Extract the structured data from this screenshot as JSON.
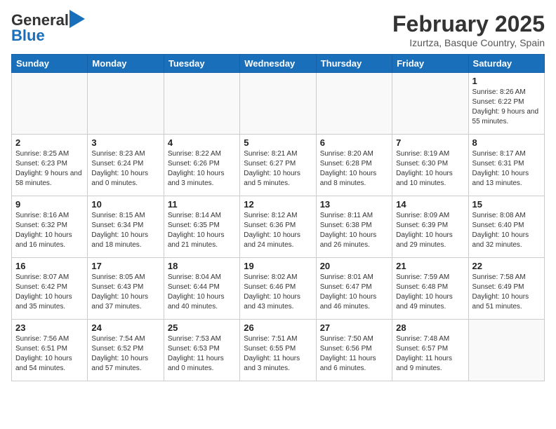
{
  "header": {
    "logo_general": "General",
    "logo_blue": "Blue",
    "title": "February 2025",
    "location": "Izurtza, Basque Country, Spain"
  },
  "days_of_week": [
    "Sunday",
    "Monday",
    "Tuesday",
    "Wednesday",
    "Thursday",
    "Friday",
    "Saturday"
  ],
  "weeks": [
    [
      {
        "day": "",
        "info": ""
      },
      {
        "day": "",
        "info": ""
      },
      {
        "day": "",
        "info": ""
      },
      {
        "day": "",
        "info": ""
      },
      {
        "day": "",
        "info": ""
      },
      {
        "day": "",
        "info": ""
      },
      {
        "day": "1",
        "info": "Sunrise: 8:26 AM\nSunset: 6:22 PM\nDaylight: 9 hours and 55 minutes."
      }
    ],
    [
      {
        "day": "2",
        "info": "Sunrise: 8:25 AM\nSunset: 6:23 PM\nDaylight: 9 hours and 58 minutes."
      },
      {
        "day": "3",
        "info": "Sunrise: 8:23 AM\nSunset: 6:24 PM\nDaylight: 10 hours and 0 minutes."
      },
      {
        "day": "4",
        "info": "Sunrise: 8:22 AM\nSunset: 6:26 PM\nDaylight: 10 hours and 3 minutes."
      },
      {
        "day": "5",
        "info": "Sunrise: 8:21 AM\nSunset: 6:27 PM\nDaylight: 10 hours and 5 minutes."
      },
      {
        "day": "6",
        "info": "Sunrise: 8:20 AM\nSunset: 6:28 PM\nDaylight: 10 hours and 8 minutes."
      },
      {
        "day": "7",
        "info": "Sunrise: 8:19 AM\nSunset: 6:30 PM\nDaylight: 10 hours and 10 minutes."
      },
      {
        "day": "8",
        "info": "Sunrise: 8:17 AM\nSunset: 6:31 PM\nDaylight: 10 hours and 13 minutes."
      }
    ],
    [
      {
        "day": "9",
        "info": "Sunrise: 8:16 AM\nSunset: 6:32 PM\nDaylight: 10 hours and 16 minutes."
      },
      {
        "day": "10",
        "info": "Sunrise: 8:15 AM\nSunset: 6:34 PM\nDaylight: 10 hours and 18 minutes."
      },
      {
        "day": "11",
        "info": "Sunrise: 8:14 AM\nSunset: 6:35 PM\nDaylight: 10 hours and 21 minutes."
      },
      {
        "day": "12",
        "info": "Sunrise: 8:12 AM\nSunset: 6:36 PM\nDaylight: 10 hours and 24 minutes."
      },
      {
        "day": "13",
        "info": "Sunrise: 8:11 AM\nSunset: 6:38 PM\nDaylight: 10 hours and 26 minutes."
      },
      {
        "day": "14",
        "info": "Sunrise: 8:09 AM\nSunset: 6:39 PM\nDaylight: 10 hours and 29 minutes."
      },
      {
        "day": "15",
        "info": "Sunrise: 8:08 AM\nSunset: 6:40 PM\nDaylight: 10 hours and 32 minutes."
      }
    ],
    [
      {
        "day": "16",
        "info": "Sunrise: 8:07 AM\nSunset: 6:42 PM\nDaylight: 10 hours and 35 minutes."
      },
      {
        "day": "17",
        "info": "Sunrise: 8:05 AM\nSunset: 6:43 PM\nDaylight: 10 hours and 37 minutes."
      },
      {
        "day": "18",
        "info": "Sunrise: 8:04 AM\nSunset: 6:44 PM\nDaylight: 10 hours and 40 minutes."
      },
      {
        "day": "19",
        "info": "Sunrise: 8:02 AM\nSunset: 6:46 PM\nDaylight: 10 hours and 43 minutes."
      },
      {
        "day": "20",
        "info": "Sunrise: 8:01 AM\nSunset: 6:47 PM\nDaylight: 10 hours and 46 minutes."
      },
      {
        "day": "21",
        "info": "Sunrise: 7:59 AM\nSunset: 6:48 PM\nDaylight: 10 hours and 49 minutes."
      },
      {
        "day": "22",
        "info": "Sunrise: 7:58 AM\nSunset: 6:49 PM\nDaylight: 10 hours and 51 minutes."
      }
    ],
    [
      {
        "day": "23",
        "info": "Sunrise: 7:56 AM\nSunset: 6:51 PM\nDaylight: 10 hours and 54 minutes."
      },
      {
        "day": "24",
        "info": "Sunrise: 7:54 AM\nSunset: 6:52 PM\nDaylight: 10 hours and 57 minutes."
      },
      {
        "day": "25",
        "info": "Sunrise: 7:53 AM\nSunset: 6:53 PM\nDaylight: 11 hours and 0 minutes."
      },
      {
        "day": "26",
        "info": "Sunrise: 7:51 AM\nSunset: 6:55 PM\nDaylight: 11 hours and 3 minutes."
      },
      {
        "day": "27",
        "info": "Sunrise: 7:50 AM\nSunset: 6:56 PM\nDaylight: 11 hours and 6 minutes."
      },
      {
        "day": "28",
        "info": "Sunrise: 7:48 AM\nSunset: 6:57 PM\nDaylight: 11 hours and 9 minutes."
      },
      {
        "day": "",
        "info": ""
      }
    ]
  ]
}
